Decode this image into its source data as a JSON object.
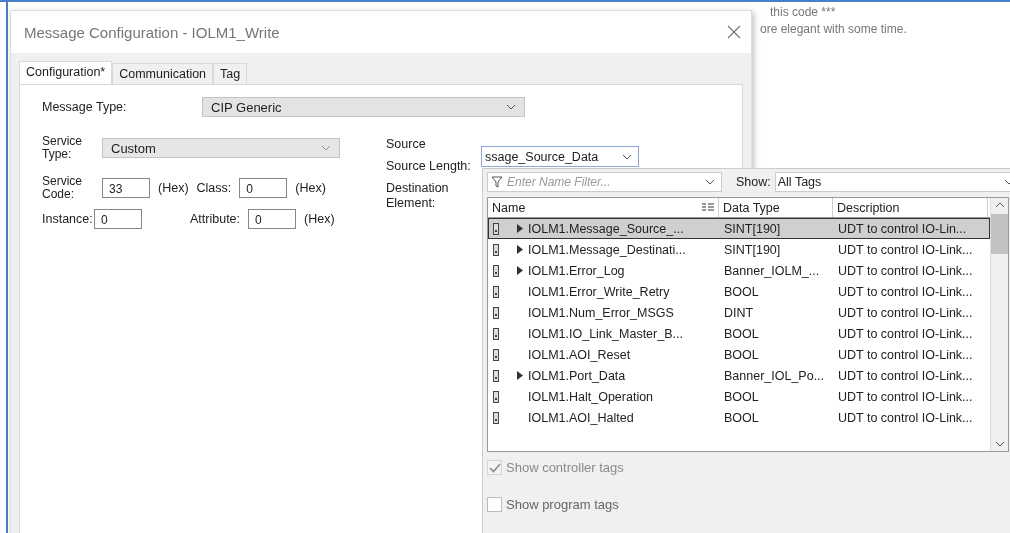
{
  "background_document": {
    "lines": [
      "this code ***",
      "ore elegant with some time."
    ]
  },
  "window": {
    "title": "Message Configuration - IOLM1_Write"
  },
  "tabs": [
    {
      "label": "Configuration*",
      "selected": true
    },
    {
      "label": "Communication",
      "selected": false
    },
    {
      "label": "Tag",
      "selected": false
    }
  ],
  "message_type": {
    "label": "Message Type:",
    "value": "CIP Generic"
  },
  "service_type": {
    "label": "Service Type:",
    "value": "Custom"
  },
  "service_code": {
    "label": "Service Code:",
    "value": "33",
    "unit": "(Hex)"
  },
  "class": {
    "label": "Class:",
    "value": "0",
    "unit": "(Hex)"
  },
  "instance": {
    "label": "Instance:",
    "value": "0"
  },
  "attribute": {
    "label": "Attribute:",
    "value": "0",
    "unit": "(Hex)"
  },
  "source": {
    "label": "Source",
    "value": "ssage_Source_Data"
  },
  "source_length": {
    "label": "Source Length:"
  },
  "destination_element": {
    "label": "Destination Element:"
  },
  "tag_browser": {
    "filter_placeholder": "Enter Name Filter...",
    "show_label": "Show:",
    "show_value": "All Tags",
    "columns": [
      "Name",
      "Data Type",
      "Description"
    ],
    "rows": [
      {
        "name": "IOLM1.Message_Source_...",
        "data_type": "SINT[190]",
        "description": "UDT to control IO-Lin...",
        "expandable": true,
        "selected": true
      },
      {
        "name": "IOLM1.Message_Destinati...",
        "data_type": "SINT[190]",
        "description": "UDT to control IO-Link...",
        "expandable": true,
        "selected": false
      },
      {
        "name": "IOLM1.Error_Log",
        "data_type": "Banner_IOLM_...",
        "description": "UDT to control IO-Link...",
        "expandable": true,
        "selected": false
      },
      {
        "name": "IOLM1.Error_Write_Retry",
        "data_type": "BOOL",
        "description": "UDT to control IO-Link...",
        "expandable": false,
        "selected": false
      },
      {
        "name": "IOLM1.Num_Error_MSGS",
        "data_type": "DINT",
        "description": "UDT to control IO-Link...",
        "expandable": false,
        "selected": false
      },
      {
        "name": "IOLM1.IO_Link_Master_B...",
        "data_type": "BOOL",
        "description": "UDT to control IO-Link...",
        "expandable": false,
        "selected": false
      },
      {
        "name": "IOLM1.AOI_Reset",
        "data_type": "BOOL",
        "description": "UDT to control IO-Link...",
        "expandable": false,
        "selected": false
      },
      {
        "name": "IOLM1.Port_Data",
        "data_type": "Banner_IOL_Po...",
        "description": "UDT to control IO-Link...",
        "expandable": true,
        "selected": false
      },
      {
        "name": "IOLM1.Halt_Operation",
        "data_type": "BOOL",
        "description": "UDT to control IO-Link...",
        "expandable": false,
        "selected": false
      },
      {
        "name": "IOLM1.AOI_Halted",
        "data_type": "BOOL",
        "description": "UDT to control IO-Link...",
        "expandable": false,
        "selected": false
      }
    ],
    "options": [
      {
        "label": "Show controller tags",
        "checked": true,
        "disabled": true
      },
      {
        "label": "Show program tags",
        "checked": false,
        "disabled": false
      }
    ]
  }
}
